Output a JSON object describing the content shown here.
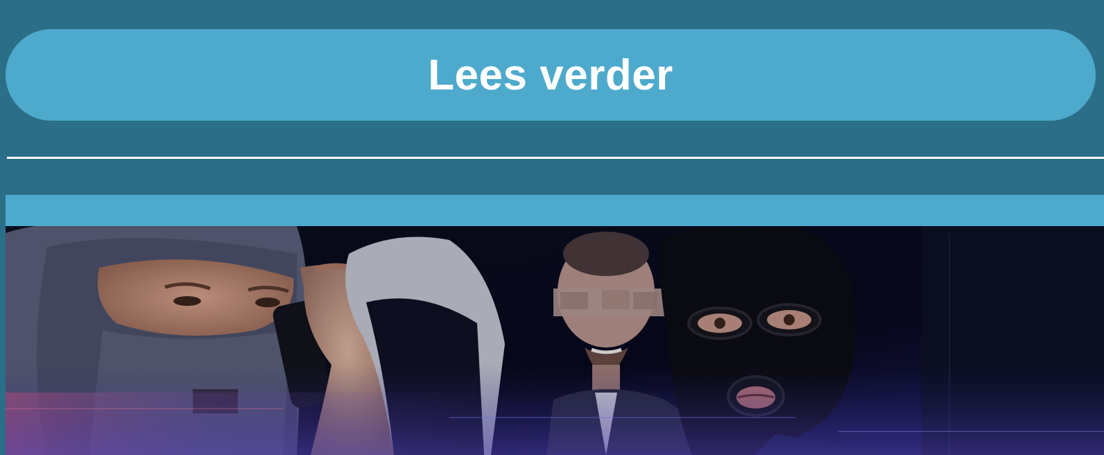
{
  "read_more": {
    "label": "Lees verder"
  },
  "colors": {
    "background": "#2b6e88",
    "button": "#4eaacc",
    "button_text": "#ffffff",
    "divider": "#ffffff"
  },
  "hero_image": {
    "description_icon": "photo-collage-masked-men"
  }
}
